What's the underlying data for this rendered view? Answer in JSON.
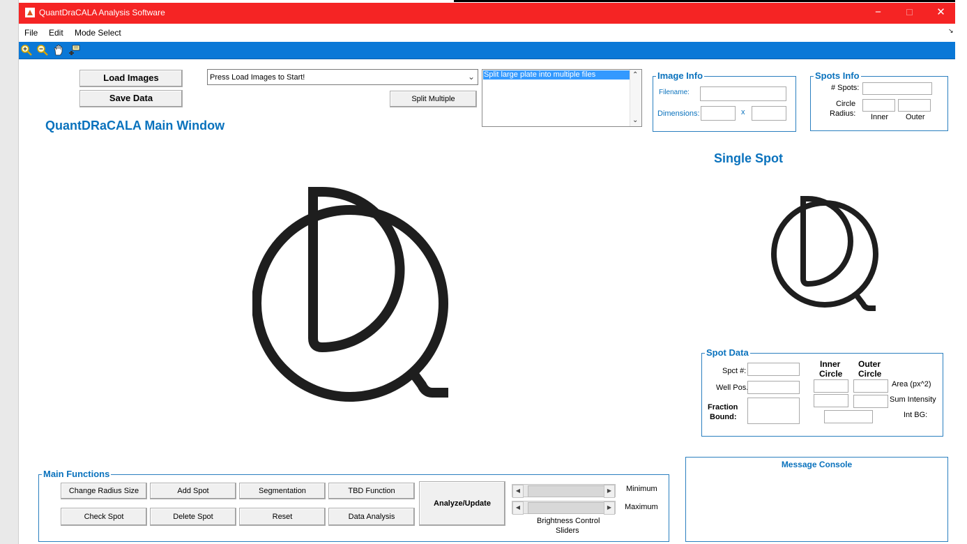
{
  "window": {
    "title": "QuantDraCALA Analysis Software",
    "controls": {
      "minimize": "−",
      "maximize": "☐",
      "close": "✕"
    }
  },
  "menu": {
    "items": [
      "File",
      "Edit",
      "Mode Select"
    ],
    "overflow": "↘"
  },
  "toolbar": {
    "icons": [
      "zoom-in-icon",
      "zoom-out-icon",
      "pan-hand-icon",
      "data-cursor-icon"
    ]
  },
  "top_controls": {
    "load_images": "Load Images",
    "save_data": "Save Data",
    "image_select": "Press Load Images to Start!",
    "split_multiple": "Split Multiple",
    "list_items": [
      "Split large plate into multiple files"
    ]
  },
  "main_title": "QuantDRaCALA Main Window",
  "image_info": {
    "title": "Image Info",
    "filename_label": "Filename:",
    "dimensions_label": "Dimensions:",
    "x_sep": "x"
  },
  "spots_info": {
    "title": "Spots Info",
    "num_spots_label": "# Spots:",
    "circle_radius_label_1": "Circle",
    "circle_radius_label_2": "Radius:",
    "inner_label": "Inner",
    "outer_label": "Outer"
  },
  "single_spot_title": "Single Spot",
  "spot_data": {
    "title": "Spot Data",
    "spot_num_label": "Spct #:",
    "well_pos_label": "Well Pos.",
    "fraction_bound_label_1": "Fraction",
    "fraction_bound_label_2": "Bound:",
    "inner_circle_1": "Inner",
    "inner_circle_2": "Circle",
    "outer_circle_1": "Outer",
    "outer_circle_2": "Circle",
    "area_label": "Area (px^2)",
    "sum_intensity_label": "Sum Intensity",
    "int_bg_label": "Int BG:"
  },
  "main_functions": {
    "title": "Main Functions",
    "buttons_row1": [
      "Change Radius Size",
      "Add Spot",
      "Segmentation",
      "TBD Function"
    ],
    "buttons_row2": [
      "Check Spot",
      "Delete Spot",
      "Reset",
      "Data Analysis"
    ],
    "analyze": "Analyze/Update",
    "minimum_label": "Minimum",
    "maximum_label": "Maximum",
    "brightness_label_1": "Brightness Control",
    "brightness_label_2": "Sliders"
  },
  "message_console": {
    "title": "Message Console"
  },
  "colors": {
    "titlebar": "#f52424",
    "toolbar": "#0a78d7",
    "accent_text": "#0a72bd",
    "list_selected": "#3399ff"
  }
}
